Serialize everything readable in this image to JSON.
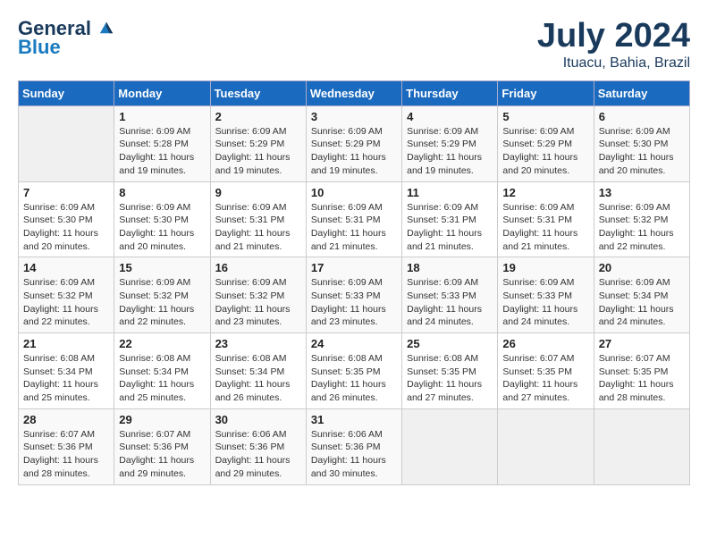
{
  "header": {
    "logo_line1": "General",
    "logo_line2": "Blue",
    "month": "July 2024",
    "location": "Ituacu, Bahia, Brazil"
  },
  "days_of_week": [
    "Sunday",
    "Monday",
    "Tuesday",
    "Wednesday",
    "Thursday",
    "Friday",
    "Saturday"
  ],
  "weeks": [
    [
      {
        "num": "",
        "detail": ""
      },
      {
        "num": "1",
        "detail": "Sunrise: 6:09 AM\nSunset: 5:28 PM\nDaylight: 11 hours\nand 19 minutes."
      },
      {
        "num": "2",
        "detail": "Sunrise: 6:09 AM\nSunset: 5:29 PM\nDaylight: 11 hours\nand 19 minutes."
      },
      {
        "num": "3",
        "detail": "Sunrise: 6:09 AM\nSunset: 5:29 PM\nDaylight: 11 hours\nand 19 minutes."
      },
      {
        "num": "4",
        "detail": "Sunrise: 6:09 AM\nSunset: 5:29 PM\nDaylight: 11 hours\nand 19 minutes."
      },
      {
        "num": "5",
        "detail": "Sunrise: 6:09 AM\nSunset: 5:29 PM\nDaylight: 11 hours\nand 20 minutes."
      },
      {
        "num": "6",
        "detail": "Sunrise: 6:09 AM\nSunset: 5:30 PM\nDaylight: 11 hours\nand 20 minutes."
      }
    ],
    [
      {
        "num": "7",
        "detail": "Sunrise: 6:09 AM\nSunset: 5:30 PM\nDaylight: 11 hours\nand 20 minutes."
      },
      {
        "num": "8",
        "detail": "Sunrise: 6:09 AM\nSunset: 5:30 PM\nDaylight: 11 hours\nand 20 minutes."
      },
      {
        "num": "9",
        "detail": "Sunrise: 6:09 AM\nSunset: 5:31 PM\nDaylight: 11 hours\nand 21 minutes."
      },
      {
        "num": "10",
        "detail": "Sunrise: 6:09 AM\nSunset: 5:31 PM\nDaylight: 11 hours\nand 21 minutes."
      },
      {
        "num": "11",
        "detail": "Sunrise: 6:09 AM\nSunset: 5:31 PM\nDaylight: 11 hours\nand 21 minutes."
      },
      {
        "num": "12",
        "detail": "Sunrise: 6:09 AM\nSunset: 5:31 PM\nDaylight: 11 hours\nand 21 minutes."
      },
      {
        "num": "13",
        "detail": "Sunrise: 6:09 AM\nSunset: 5:32 PM\nDaylight: 11 hours\nand 22 minutes."
      }
    ],
    [
      {
        "num": "14",
        "detail": "Sunrise: 6:09 AM\nSunset: 5:32 PM\nDaylight: 11 hours\nand 22 minutes."
      },
      {
        "num": "15",
        "detail": "Sunrise: 6:09 AM\nSunset: 5:32 PM\nDaylight: 11 hours\nand 22 minutes."
      },
      {
        "num": "16",
        "detail": "Sunrise: 6:09 AM\nSunset: 5:32 PM\nDaylight: 11 hours\nand 23 minutes."
      },
      {
        "num": "17",
        "detail": "Sunrise: 6:09 AM\nSunset: 5:33 PM\nDaylight: 11 hours\nand 23 minutes."
      },
      {
        "num": "18",
        "detail": "Sunrise: 6:09 AM\nSunset: 5:33 PM\nDaylight: 11 hours\nand 24 minutes."
      },
      {
        "num": "19",
        "detail": "Sunrise: 6:09 AM\nSunset: 5:33 PM\nDaylight: 11 hours\nand 24 minutes."
      },
      {
        "num": "20",
        "detail": "Sunrise: 6:09 AM\nSunset: 5:34 PM\nDaylight: 11 hours\nand 24 minutes."
      }
    ],
    [
      {
        "num": "21",
        "detail": "Sunrise: 6:08 AM\nSunset: 5:34 PM\nDaylight: 11 hours\nand 25 minutes."
      },
      {
        "num": "22",
        "detail": "Sunrise: 6:08 AM\nSunset: 5:34 PM\nDaylight: 11 hours\nand 25 minutes."
      },
      {
        "num": "23",
        "detail": "Sunrise: 6:08 AM\nSunset: 5:34 PM\nDaylight: 11 hours\nand 26 minutes."
      },
      {
        "num": "24",
        "detail": "Sunrise: 6:08 AM\nSunset: 5:35 PM\nDaylight: 11 hours\nand 26 minutes."
      },
      {
        "num": "25",
        "detail": "Sunrise: 6:08 AM\nSunset: 5:35 PM\nDaylight: 11 hours\nand 27 minutes."
      },
      {
        "num": "26",
        "detail": "Sunrise: 6:07 AM\nSunset: 5:35 PM\nDaylight: 11 hours\nand 27 minutes."
      },
      {
        "num": "27",
        "detail": "Sunrise: 6:07 AM\nSunset: 5:35 PM\nDaylight: 11 hours\nand 28 minutes."
      }
    ],
    [
      {
        "num": "28",
        "detail": "Sunrise: 6:07 AM\nSunset: 5:36 PM\nDaylight: 11 hours\nand 28 minutes."
      },
      {
        "num": "29",
        "detail": "Sunrise: 6:07 AM\nSunset: 5:36 PM\nDaylight: 11 hours\nand 29 minutes."
      },
      {
        "num": "30",
        "detail": "Sunrise: 6:06 AM\nSunset: 5:36 PM\nDaylight: 11 hours\nand 29 minutes."
      },
      {
        "num": "31",
        "detail": "Sunrise: 6:06 AM\nSunset: 5:36 PM\nDaylight: 11 hours\nand 30 minutes."
      },
      {
        "num": "",
        "detail": ""
      },
      {
        "num": "",
        "detail": ""
      },
      {
        "num": "",
        "detail": ""
      }
    ]
  ]
}
